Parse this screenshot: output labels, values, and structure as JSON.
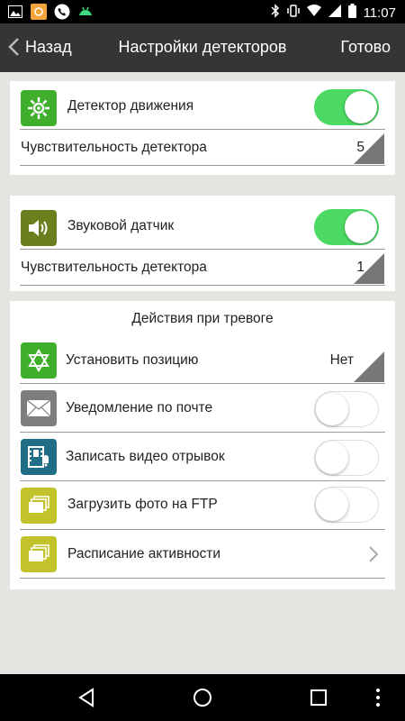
{
  "status_bar": {
    "time": "11:07",
    "icons": [
      "image-icon",
      "camera-app-icon",
      "phone-icon",
      "android-icon",
      "bluetooth-icon",
      "vibrate-icon",
      "wifi-icon",
      "signal-icon",
      "battery-icon"
    ]
  },
  "header": {
    "back_label": "Назад",
    "title": "Настройки детекторов",
    "done_label": "Готово"
  },
  "motion_card": {
    "label": "Детектор движения",
    "icon": "motion-detector-icon",
    "icon_color": "#3fae2a",
    "toggle_on": true,
    "sensitivity_label": "Чувствительность детектора",
    "sensitivity_value": "5"
  },
  "sound_card": {
    "label": "Звуковой датчик",
    "icon": "speaker-icon",
    "icon_color": "#6b7f1e",
    "toggle_on": true,
    "sensitivity_label": "Чувствительность детектора",
    "sensitivity_value": "1"
  },
  "alarm_card": {
    "title": "Действия при тревоге",
    "set_position": {
      "label": "Установить позицию",
      "value": "Нет",
      "icon": "star-of-david-icon",
      "icon_color": "#3fae2a"
    },
    "email": {
      "label": "Уведомление по почте",
      "icon": "envelope-icon",
      "icon_color": "#7d7d7d",
      "toggle_on": false
    },
    "record_video": {
      "label": "Записать видео отрывок",
      "icon": "film-bell-icon",
      "icon_color": "#1f6e86",
      "toggle_on": false
    },
    "ftp": {
      "label": "Загрузить фото на FTP",
      "icon": "photos-stack-icon",
      "icon_color": "#c2c22a",
      "toggle_on": false
    },
    "schedule": {
      "label": "Расписание активности",
      "icon": "photos-stack-icon",
      "icon_color": "#c2c22a"
    }
  },
  "colors": {
    "toggle_on": "#4cd964",
    "header_bg": "#353535",
    "page_bg": "#e6e4e1"
  }
}
